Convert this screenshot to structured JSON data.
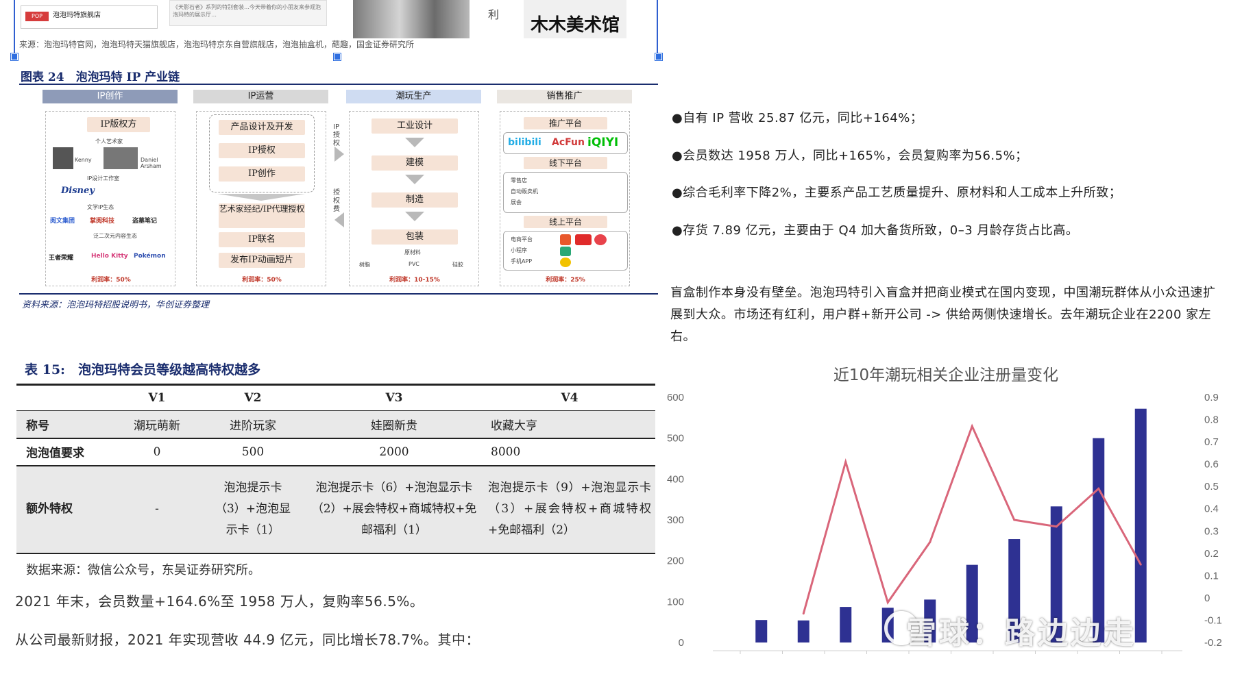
{
  "top_strip": {
    "store_logo": "POP MART",
    "store_name": "泡泡玛特旗舰店",
    "review_text": "《天影石者》系列的特别套装…今天带着你的小朋友来参观泡泡玛特的展示厅…",
    "side_char": "利",
    "museum_title": "木木美术馆",
    "source": "来源：泡泡玛特官网，泡泡玛特天猫旗舰店，泡泡玛特京东自营旗舰店，泡泡抽盒机，葩趣，国金证券研究所"
  },
  "figure24": {
    "title": "图表 24　泡泡玛特 IP 产业链",
    "stages": [
      "IP创作",
      "IP运营",
      "潮玩生产",
      "销售推广"
    ],
    "creation": {
      "ip_source": "IP版权方",
      "artist_label": "个人艺术家",
      "artists": [
        "Kenny",
        "Molly",
        "Daniel Arsham"
      ],
      "studio_label": "IP设计工作室",
      "disney": "Disney",
      "literature_label": "文学IP生态",
      "publishers": [
        "阅文集团",
        "掌阅科技",
        "盗墓笔记"
      ],
      "acg_label": "泛二次元内容生态",
      "acg_brands": [
        "王者荣耀",
        "Hello Kitty",
        "Pokémon"
      ],
      "margin": "利润率：50%"
    },
    "operation": {
      "items_top": [
        "产品设计及开发",
        "IP授权",
        "IP创作"
      ],
      "items_bottom": [
        "艺术家经纪/IP代理授权",
        "IP联名",
        "发布IP动画短片"
      ],
      "ip_license": "IP授权",
      "license_fee": "授权费",
      "margin": "利润率：50%"
    },
    "production": {
      "steps": [
        "工业设计",
        "建模",
        "制造",
        "包装"
      ],
      "raw_label": "原材料",
      "materials": [
        "树脂",
        "PVC",
        "硅胶"
      ],
      "margin": "利润率：10-15%"
    },
    "sales": {
      "promo": "推广平台",
      "platforms": [
        "bilibili",
        "AcFun",
        "iQIYI"
      ],
      "offline": "线下平台",
      "offline_items": [
        "零售店",
        "自动贩卖机",
        "展会"
      ],
      "online": "线上平台",
      "online_items": [
        "电商平台",
        "小程序",
        "手机APP"
      ],
      "margin": "利润率：25%"
    },
    "source": "资料来源：泡泡玛特招股说明书，华创证券整理"
  },
  "table15": {
    "title": "表 15:　泡泡玛特会员等级越高特权越多",
    "headers": [
      "",
      "V1",
      "V2",
      "V3",
      "V4"
    ],
    "rows": [
      [
        "称号",
        "潮玩萌新",
        "进阶玩家",
        "娃圈新贵",
        "收藏大亨"
      ],
      [
        "泡泡值要求",
        "0",
        "500",
        "2000",
        "8000"
      ],
      [
        "额外特权",
        "-",
        "泡泡提示卡（3）+泡泡显示卡（1）",
        "泡泡提示卡（6）+泡泡显示卡（2）+展会特权+商城特权+免邮福利（1）",
        "泡泡提示卡（9）+泡泡显示卡（3）+展会特权+商城特权+免邮福利（2）"
      ]
    ],
    "source": "数据来源：微信公众号，东吴证券研究所。"
  },
  "left_paras": [
    "2021 年末，会员数量+164.6%至 1958 万人，复购率56.5%。",
    "从公司最新财报，2021 年实现营收 44.9 亿元，同比增长78.7%。其中："
  ],
  "bullets": [
    "●自有 IP 营收 25.87 亿元，同比+164%；",
    "●会员数达 1958 万人，同比+165%，会员复购率为56.5%；",
    "●综合毛利率下降2%，主要系产品工艺质量提升、原材料和人工成本上升所致；",
    "●存货 7.89 亿元，主要由于 Q4 加大备货所致，0–3 月龄存货占比高。"
  ],
  "right_para": "盲盒制作本身没有壁垒。泡泡玛特引入盲盒并把商业模式在国内变现，中国潮玩群体从小众迅速扩展到大众。市场还有红利，用户群+新开公司 -> 供给两侧快速增长。去年潮玩企业在2200 家左右。",
  "watermark": "雪球：路边边走",
  "colors": {
    "bar": "#2e3192",
    "line": "#d9667a",
    "navy": "#1a2d6e"
  },
  "chart_data": {
    "type": "bar",
    "title": "近10年潮玩相关企业注册量变化",
    "categories": [
      "",
      "",
      "",
      "",
      "",
      "",
      "",
      "",
      "",
      ""
    ],
    "series": [
      {
        "type": "bar",
        "axis": "left",
        "values": [
          55,
          54,
          87,
          85,
          105,
          190,
          253,
          333,
          500,
          572
        ]
      },
      {
        "type": "line",
        "axis": "right",
        "values": [
          null,
          -0.07,
          0.61,
          -0.02,
          0.25,
          0.77,
          0.35,
          0.32,
          0.49,
          0.15
        ]
      }
    ],
    "y_left": {
      "min": 0,
      "max": 600,
      "ticks": [
        0,
        100,
        200,
        300,
        400,
        500,
        600
      ]
    },
    "y_right": {
      "min": -0.2,
      "max": 0.9,
      "ticks": [
        -0.2,
        -0.1,
        0,
        0.1,
        0.2,
        0.3,
        0.4,
        0.5,
        0.6,
        0.7,
        0.8,
        0.9
      ]
    },
    "grid": false
  }
}
